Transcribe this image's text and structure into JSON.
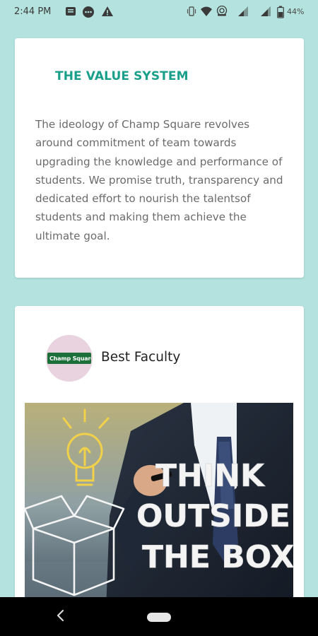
{
  "status_bar": {
    "time": "2:44 PM",
    "battery": "44%",
    "icons": [
      "notification-icon",
      "chat-icon",
      "alert-icon",
      "vibrate-icon",
      "wifi-icon",
      "hotspot-icon",
      "signal-icon",
      "signal-icon",
      "battery-icon"
    ]
  },
  "value_card": {
    "title": "THE VALUE SYSTEM",
    "body": "The ideology of Champ Square revolves around commitment of team towards upgrading the knowledge and performance of students. We promise truth, transparency and dedicated effort to nourish the talentsof students and making them achieve the ultimate goal."
  },
  "faculty_card": {
    "name": "Best Faculty",
    "logo": "Champ Square",
    "image_text": [
      "THINK",
      "OUTSIDE",
      "THE BOX"
    ]
  },
  "colors": {
    "background": "#b4e3df",
    "title_accent": "#1a9f8a",
    "body_text": "#6b6b6b"
  },
  "nav": {
    "back": "back-icon",
    "home": "home-icon"
  }
}
